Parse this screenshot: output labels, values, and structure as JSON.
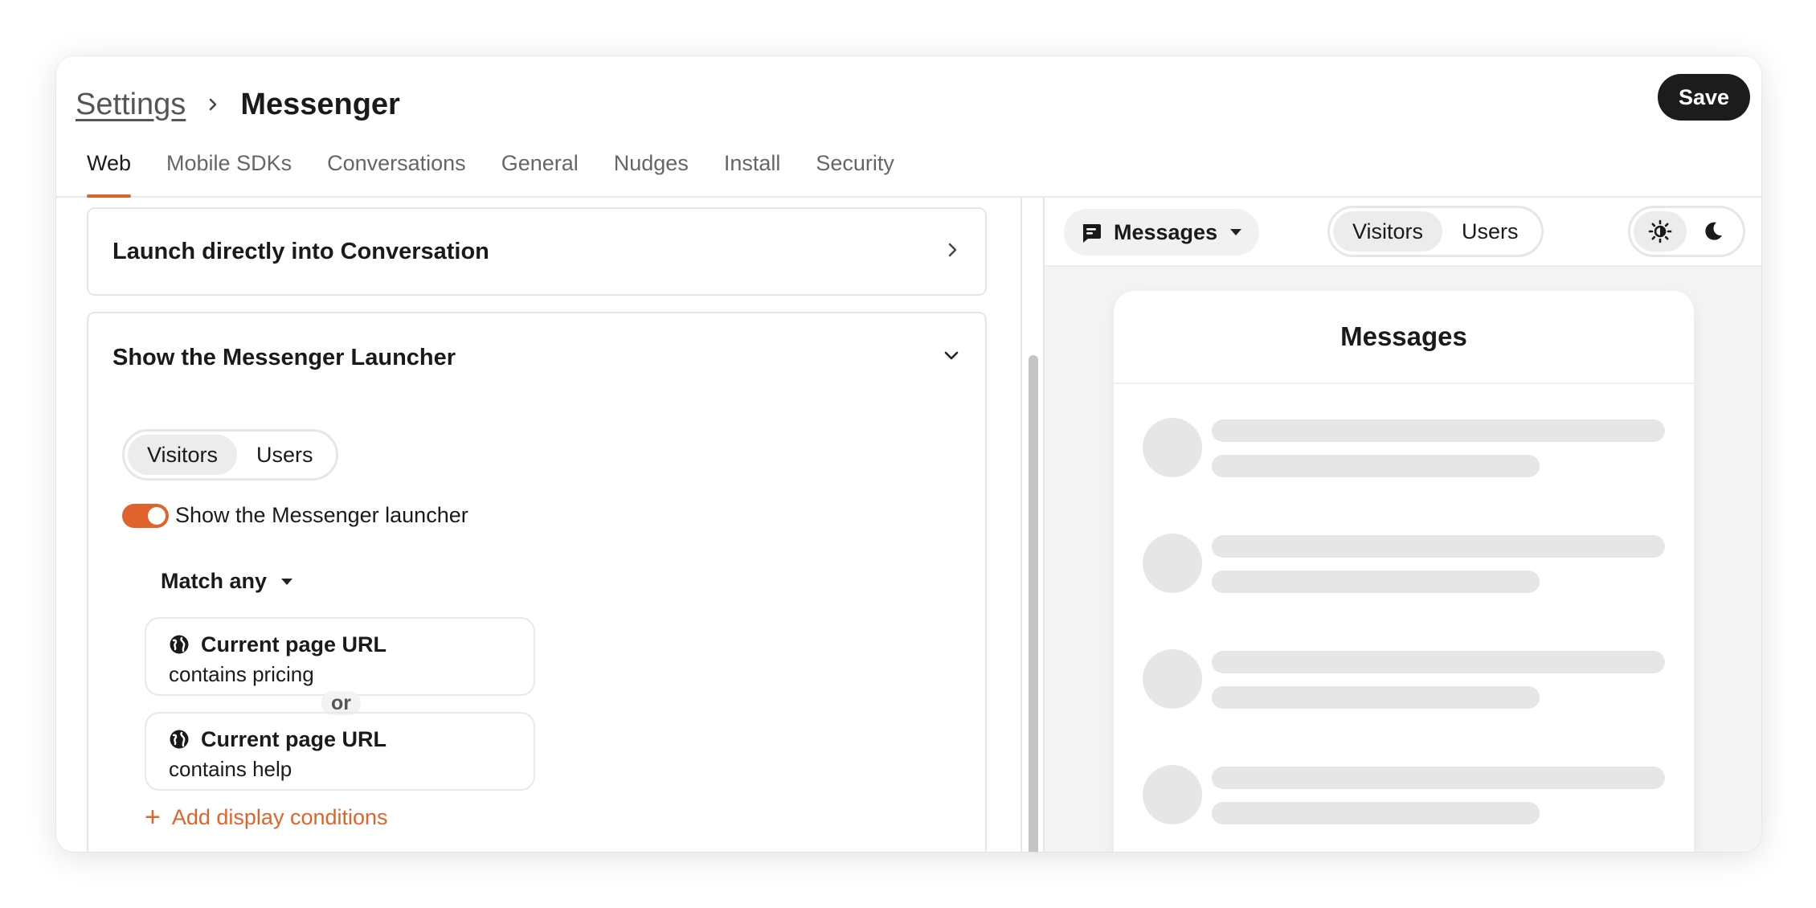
{
  "breadcrumb": {
    "parent": "Settings",
    "current": "Messenger"
  },
  "header": {
    "save_label": "Save"
  },
  "tabs": [
    {
      "label": "Web",
      "active": true
    },
    {
      "label": "Mobile SDKs"
    },
    {
      "label": "Conversations"
    },
    {
      "label": "General"
    },
    {
      "label": "Nudges"
    },
    {
      "label": "Install"
    },
    {
      "label": "Security"
    }
  ],
  "sections": {
    "launch": {
      "title": "Launch directly into Conversation"
    },
    "launcher": {
      "title": "Show the Messenger Launcher",
      "audience": {
        "options": [
          "Visitors",
          "Users"
        ],
        "selected": "Visitors"
      },
      "toggle": {
        "label": "Show the Messenger launcher",
        "on": true
      },
      "match": {
        "label": "Match any"
      },
      "conditions": [
        {
          "attribute": "Current page URL",
          "rule": "contains pricing"
        },
        {
          "attribute": "Current page URL",
          "rule": "contains help"
        }
      ],
      "joiner": "or",
      "add_label": "Add display conditions"
    }
  },
  "preview": {
    "view_dropdown": "Messages",
    "audience": {
      "options": [
        "Visitors",
        "Users"
      ],
      "selected": "Visitors"
    },
    "theme": {
      "selected": "light"
    },
    "screen_title": "Messages",
    "skeleton_rows": 4
  },
  "colors": {
    "accent": "#e0632b",
    "primary_button": "#1c1c1c"
  }
}
